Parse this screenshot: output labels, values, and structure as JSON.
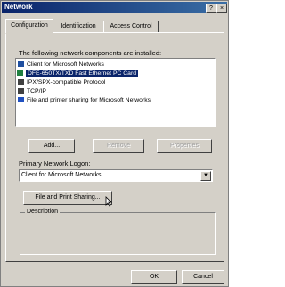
{
  "window": {
    "title": "Network",
    "help_label": "?",
    "close_label": "×"
  },
  "tabs": [
    {
      "label": "Configuration",
      "active": true
    },
    {
      "label": "Identification",
      "active": false
    },
    {
      "label": "Access Control",
      "active": false
    }
  ],
  "components": {
    "heading": "The following network components are installed:",
    "items": [
      {
        "label": "Client for Microsoft Networks",
        "icon": "client-icon",
        "selected": false
      },
      {
        "label": "DFE-650TX/TXD Fast Ethernet PC Card",
        "icon": "adapter-icon",
        "selected": true
      },
      {
        "label": "IPX/SPX-compatible Protocol",
        "icon": "protocol-icon",
        "selected": false
      },
      {
        "label": "TCP/IP",
        "icon": "protocol-icon",
        "selected": false
      },
      {
        "label": "File and printer sharing for Microsoft Networks",
        "icon": "service-icon",
        "selected": false
      }
    ]
  },
  "buttons": {
    "add": "Add...",
    "remove": "Remove",
    "properties": "Properties",
    "file_print_sharing": "File and Print Sharing...",
    "ok": "OK",
    "cancel": "Cancel"
  },
  "logon": {
    "label": "Primary Network Logon:",
    "value": "Client for Microsoft Networks"
  },
  "description": {
    "legend": "Description"
  },
  "colors": {
    "title_bar": "#0a246a",
    "face": "#d4d0c8",
    "selection": "#0a246a"
  }
}
